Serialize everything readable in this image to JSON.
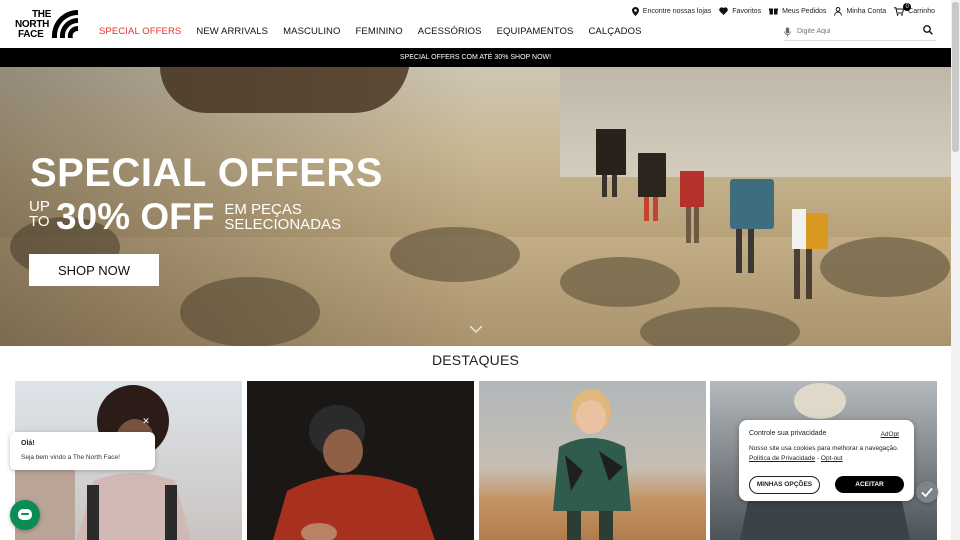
{
  "logo": {
    "line1": "THE",
    "line2": "NORTH",
    "line3": "FACE"
  },
  "utility": [
    {
      "icon": "map-pin-icon",
      "label": "Encontre nossas lojas"
    },
    {
      "icon": "heart-icon",
      "label": "Favoritos"
    },
    {
      "icon": "gift-box-icon",
      "label": "Meus Pedidos"
    },
    {
      "icon": "user-icon",
      "label": "Minha Conta"
    },
    {
      "icon": "cart-icon",
      "label": "Carrinho",
      "badge": "0"
    }
  ],
  "nav": [
    {
      "label": "SPECIAL OFFERS",
      "active": true
    },
    {
      "label": "NEW ARRIVALS"
    },
    {
      "label": "MASCULINO"
    },
    {
      "label": "FEMININO"
    },
    {
      "label": "ACESSÓRIOS"
    },
    {
      "label": "EQUIPAMENTOS"
    },
    {
      "label": "CALÇADOS"
    }
  ],
  "search": {
    "placeholder": "Digite Aqui"
  },
  "promo_bar": "SPECIAL OFFERS COM ATÉ 30% SHOP NOW!",
  "hero": {
    "title": "SPECIAL OFFERS",
    "upto_line1": "UP",
    "upto_line2": "TO",
    "percent": "30% OFF",
    "desc_line1": "EM PEÇAS",
    "desc_line2": "SELECIONADAS",
    "cta": "SHOP NOW"
  },
  "section_title": "DESTAQUES",
  "chat": {
    "greeting": "Olá!",
    "message": "Seja bem vindo a The North Face!"
  },
  "consent": {
    "title": "Controle sua privacidade",
    "adopt": "AdOpt",
    "text": "Nosso site usa cookies para melhorar a navegação.",
    "policy_link": "Política de Privacidade",
    "separator": "-",
    "optout_link": "Opt-out",
    "options_button": "MINHAS OPÇÕES",
    "accept_button": "ACEITAR"
  },
  "colors": {
    "accent": "#e4332b",
    "chat": "#0b8b56",
    "promo_bg": "#000000"
  }
}
